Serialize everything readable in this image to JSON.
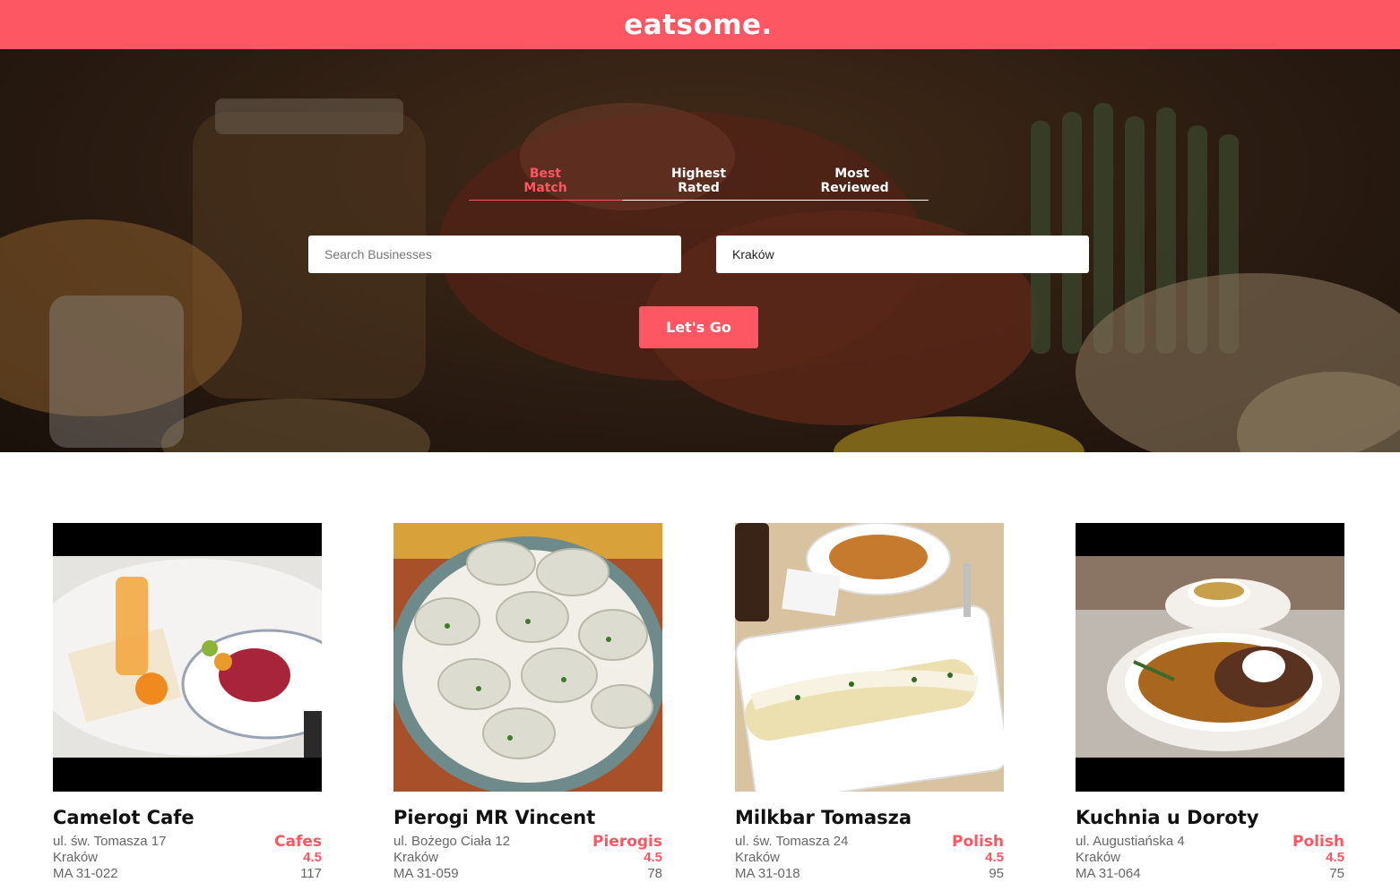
{
  "header": {
    "logo": "eatsome."
  },
  "hero": {
    "tabs": [
      {
        "label": "Best Match",
        "active": true
      },
      {
        "label": "Highest Rated",
        "active": false
      },
      {
        "label": "Most Reviewed",
        "active": false
      }
    ],
    "search": {
      "placeholder": "Search Businesses",
      "value": ""
    },
    "location": {
      "placeholder": "Where?",
      "value": "Kraków"
    },
    "submit_label": "Let's Go"
  },
  "businesses": [
    {
      "name": "Camelot Cafe",
      "address": "ul. św. Tomasza 17",
      "city": "Kraków",
      "zip": "MA 31-022",
      "category": "Cafes",
      "rating": "4.5",
      "reviews": "117"
    },
    {
      "name": "Pierogi MR Vincent",
      "address": "ul. Bożego Ciała 12",
      "city": "Kraków",
      "zip": "MA 31-059",
      "category": "Pierogis",
      "rating": "4.5",
      "reviews": "78"
    },
    {
      "name": "Milkbar Tomasza",
      "address": "ul. św. Tomasza 24",
      "city": "Kraków",
      "zip": "MA 31-018",
      "category": "Polish",
      "rating": "4.5",
      "reviews": "95"
    },
    {
      "name": "Kuchnia u Doroty",
      "address": "ul. Augustiańska 4",
      "city": "Kraków",
      "zip": "MA 31-064",
      "category": "Polish",
      "rating": "4.5",
      "reviews": "75"
    }
  ],
  "colors": {
    "accent": "#fd5764",
    "text": "#111111",
    "muted": "#666666"
  }
}
